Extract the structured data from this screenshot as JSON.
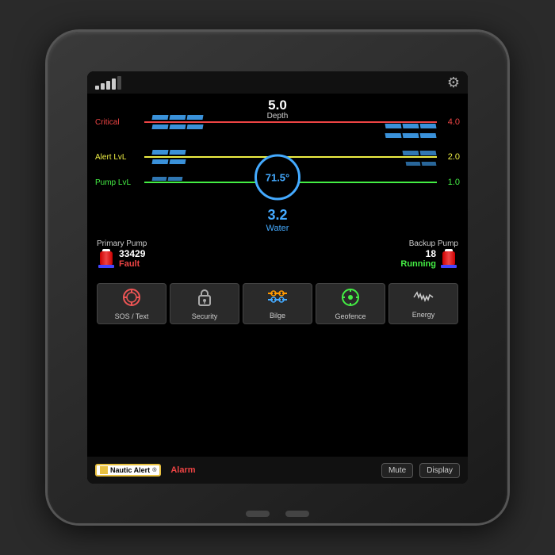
{
  "device": {
    "title": "Nautic Alert Display"
  },
  "status_bar": {
    "signal_label": "Signal",
    "settings_icon": "⚙"
  },
  "depth": {
    "value": "5.0",
    "label": "Depth"
  },
  "levels": {
    "critical": {
      "label": "Critical",
      "value": "4.0"
    },
    "alert": {
      "label": "Alert LvL",
      "value": "2.0"
    },
    "pump": {
      "label": "Pump LvL",
      "value": "1.0"
    }
  },
  "gauge": {
    "value": "71.5°"
  },
  "water": {
    "value": "3.2",
    "label": "Water"
  },
  "pumps": {
    "primary": {
      "name": "Primary Pump",
      "number": "33429",
      "status": "Fault"
    },
    "backup": {
      "name": "Backup Pump",
      "number": "18",
      "status": "Running"
    }
  },
  "nav_buttons": [
    {
      "id": "sos",
      "label": "SOS / Text",
      "icon": "🆘"
    },
    {
      "id": "security",
      "label": "Security",
      "icon": "🔒"
    },
    {
      "id": "bilge",
      "label": "Bilge",
      "icon": "≋"
    },
    {
      "id": "geofence",
      "label": "Geofence",
      "icon": "🎯"
    },
    {
      "id": "energy",
      "label": "Energy",
      "icon": "〜"
    }
  ],
  "bottom_bar": {
    "brand": "Nautic Alert",
    "brand_reg": "®",
    "alarm_label": "Alarm",
    "mute_label": "Mute",
    "display_label": "Display"
  }
}
